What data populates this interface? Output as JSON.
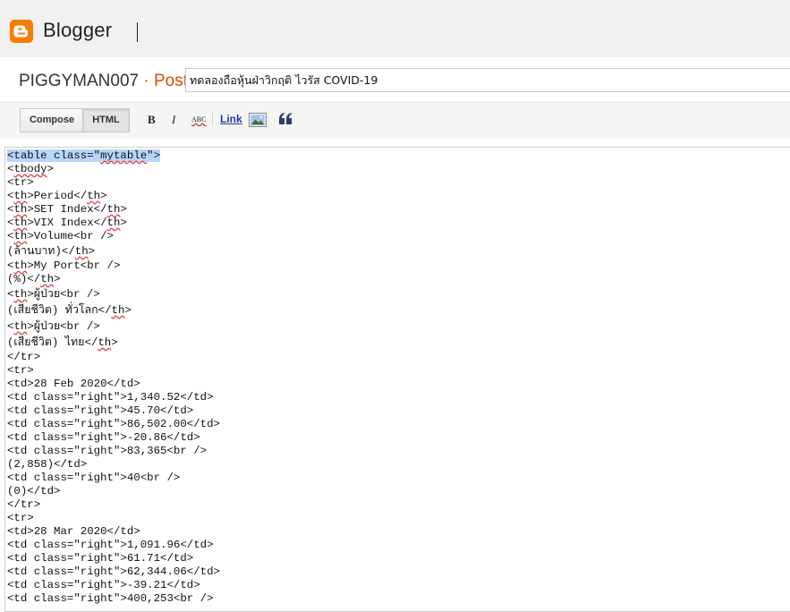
{
  "brand": {
    "name": "Blogger",
    "logo_color": "#f57d00"
  },
  "post_header": {
    "blog_name": "PIGGYMAN007",
    "separator": "·",
    "section": "Post",
    "title_value": "ทดลองถือหุ้นฝ่าวิกฤติ ไวรัส COVID-19"
  },
  "editor_tabs": {
    "compose": "Compose",
    "html": "HTML",
    "active": "HTML"
  },
  "toolbar": {
    "bold": "B",
    "italic": "I",
    "spellcheck": "ABC",
    "link": "Link",
    "image_icon": "image-icon",
    "quote_icon": "quote-icon"
  },
  "code_lines": [
    "<table class=\"mytable\">",
    "<tbody>",
    "<tr>",
    "<th>Period</th>",
    "<th>SET Index</th>",
    "<th>VIX Index</th>",
    "<th>Volume<br />",
    "(ล้านบาท)</th>",
    "<th>My Port<br />",
    "(%)</th>",
    "<th>ผู้ป่วย<br />",
    "(เสียชีวิต) ทั่วโลก</th>",
    "<th>ผู้ป่วย<br />",
    "(เสียชีวิต) ไทย</th>",
    "</tr>",
    "<tr>",
    "<td>28 Feb 2020</td>",
    "<td class=\"right\">1,340.52</td>",
    "<td class=\"right\">45.70</td>",
    "<td class=\"right\">86,502.00</td>",
    "<td class=\"right\">-20.86</td>",
    "<td class=\"right\">83,365<br />",
    "(2,858)</td>",
    "<td class=\"right\">40<br />",
    "(0)</td>",
    "</tr>",
    "<tr>",
    "<td>28 Mar 2020</td>",
    "<td class=\"right\">1,091.96</td>",
    "<td class=\"right\">61.71</td>",
    "<td class=\"right\">62,344.06</td>",
    "<td class=\"right\">-39.21</td>",
    "<td class=\"right\">400,253<br />"
  ],
  "selected_line_index": 0
}
